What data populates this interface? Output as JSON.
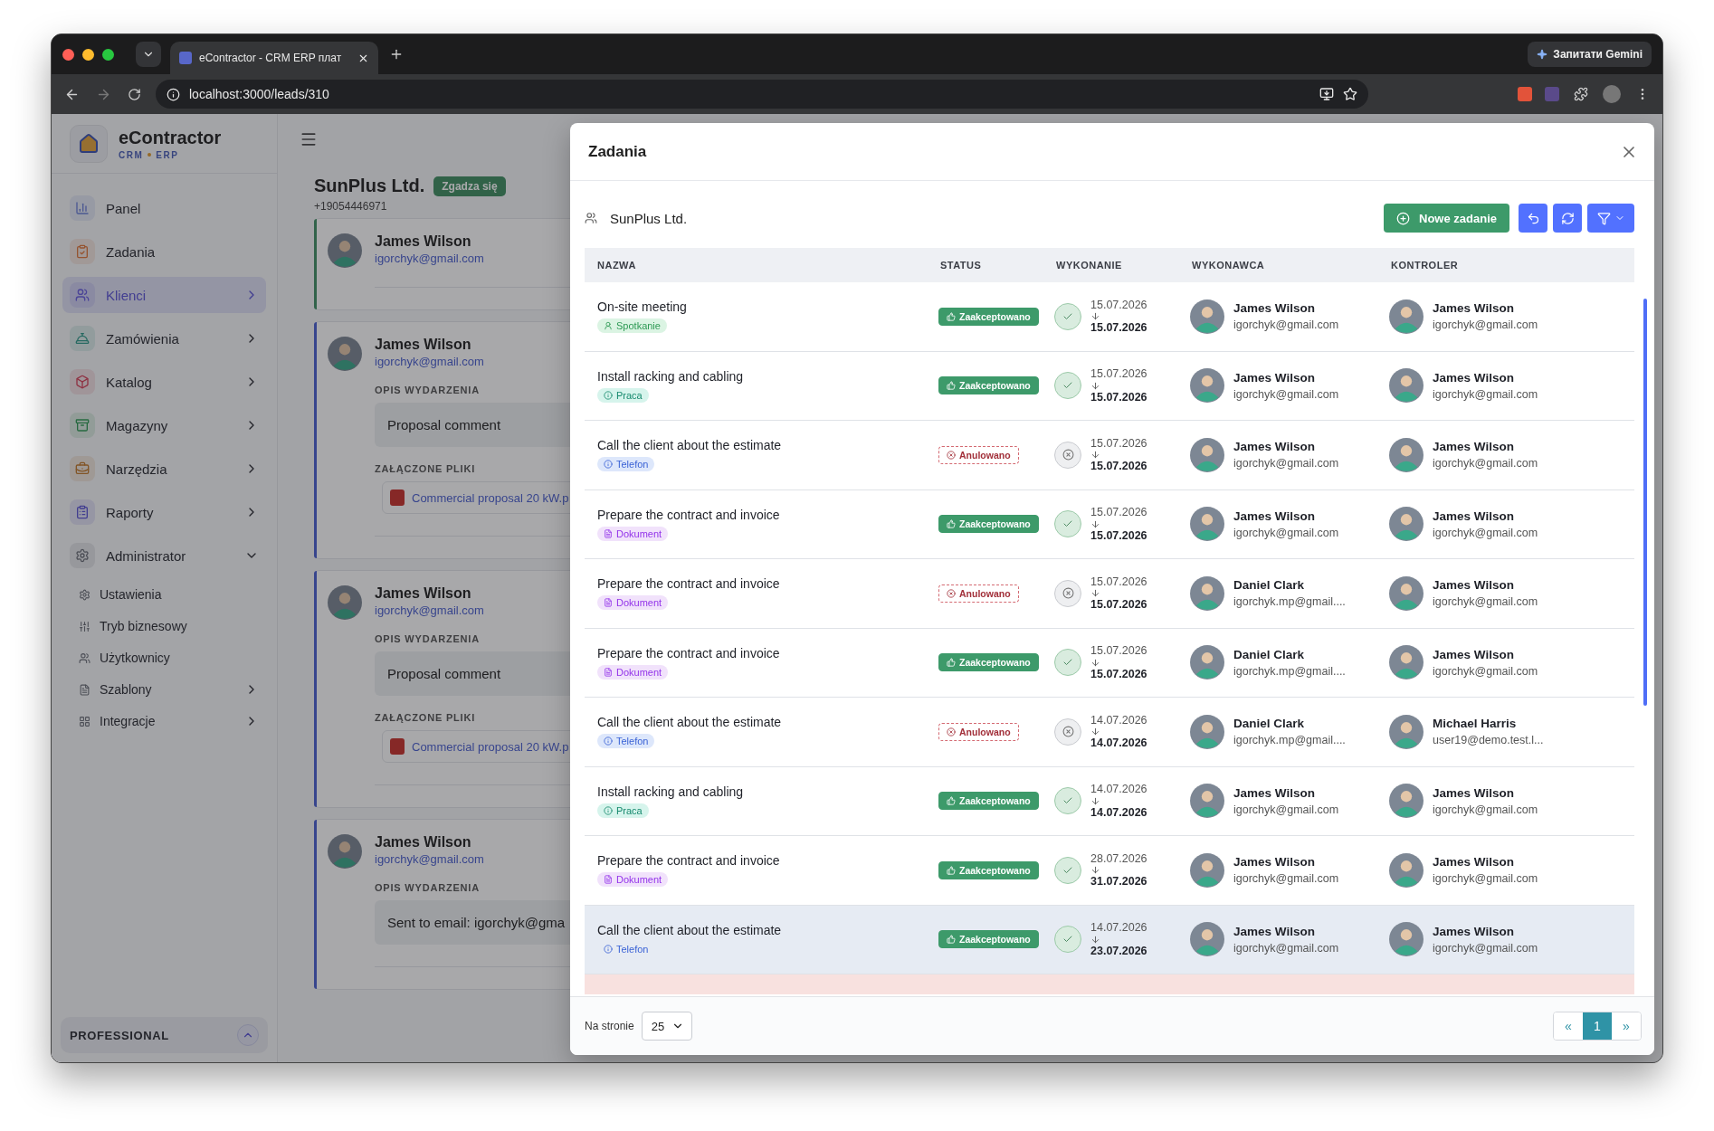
{
  "browser": {
    "tab_title": "eContractor - CRM ERP плат",
    "url": "localhost:3000/leads/310",
    "assistant_button": "Запитати Gemini"
  },
  "sidebar": {
    "brand": "eContractor",
    "brand_sub": [
      "CRM",
      "ERP"
    ],
    "items": [
      {
        "label": "Panel",
        "selected": false
      },
      {
        "label": "Zadania",
        "selected": false
      },
      {
        "label": "Klienci",
        "selected": true,
        "expanded": false
      },
      {
        "label": "Zamówienia",
        "selected": false,
        "expanded": false
      },
      {
        "label": "Katalog",
        "selected": false,
        "expanded": false
      },
      {
        "label": "Magazyny",
        "selected": false,
        "expanded": false
      },
      {
        "label": "Narzędzia",
        "selected": false,
        "expanded": false
      },
      {
        "label": "Raporty",
        "selected": false,
        "expanded": false
      },
      {
        "label": "Administrator",
        "selected": false,
        "expanded": true,
        "children": [
          {
            "label": "Ustawienia"
          },
          {
            "label": "Tryb biznesowy"
          },
          {
            "label": "Użytkownicy"
          },
          {
            "label": "Szablony",
            "expanded": false
          },
          {
            "label": "Integracje",
            "expanded": false
          }
        ]
      }
    ],
    "plan": "PROFESSIONAL"
  },
  "lead": {
    "name": "SunPlus Ltd.",
    "status": "Zgadza się",
    "phone": "+19054446971"
  },
  "events": [
    {
      "author": "James Wilson",
      "email": "igorchyk@gmail.com",
      "color": "#31634a"
    },
    {
      "author": "James Wilson",
      "email": "igorchyk@gmail.com",
      "color": "#37458d",
      "description_label": "OPIS WYDARZENIA",
      "description": "Proposal comment",
      "files_label": "ZAŁĄCZONE PLIKI",
      "files": [
        "Commercial proposal 20 kW.p"
      ]
    },
    {
      "author": "James Wilson",
      "email": "igorchyk@gmail.com",
      "color": "#37458d",
      "description_label": "OPIS WYDARZENIA",
      "description": "Proposal comment",
      "files_label": "ZAŁĄCZONE PLIKI",
      "files": [
        "Commercial proposal 20 kW.p"
      ]
    },
    {
      "author": "James Wilson",
      "email": "igorchyk@gmail.com",
      "color": "#37458d",
      "description_label": "OPIS WYDARZENIA",
      "description": "Sent to email: igorchyk@gma"
    }
  ],
  "modal": {
    "title": "Zadania",
    "client": "SunPlus Ltd.",
    "new_button": "Nowe zadanie",
    "columns": [
      "NAZWA",
      "STATUS",
      "WYKONANIE",
      "WYKONAWCA",
      "KONTROLER"
    ],
    "rows": [
      {
        "title": "On-site meeting",
        "tag": {
          "label": "Spotkanie",
          "kind": "meeting"
        },
        "status": {
          "label": "Zaakceptowano",
          "kind": "accepted"
        },
        "date_from": "15.07.2026",
        "date_to": "15.07.2026",
        "executor": {
          "name": "James Wilson",
          "email": "igorchyk@gmail.com"
        },
        "controller": {
          "name": "James Wilson",
          "email": "igorchyk@gmail.com"
        },
        "highlighted": false
      },
      {
        "title": "Install racking and cabling",
        "tag": {
          "label": "Praca",
          "kind": "work"
        },
        "status": {
          "label": "Zaakceptowano",
          "kind": "accepted"
        },
        "date_from": "15.07.2026",
        "date_to": "15.07.2026",
        "executor": {
          "name": "James Wilson",
          "email": "igorchyk@gmail.com"
        },
        "controller": {
          "name": "James Wilson",
          "email": "igorchyk@gmail.com"
        },
        "highlighted": false
      },
      {
        "title": "Call the client about the estimate",
        "tag": {
          "label": "Telefon",
          "kind": "phone"
        },
        "status": {
          "label": "Anulowano",
          "kind": "cancelled"
        },
        "date_from": "15.07.2026",
        "date_to": "15.07.2026",
        "executor": {
          "name": "James Wilson",
          "email": "igorchyk@gmail.com"
        },
        "controller": {
          "name": "James Wilson",
          "email": "igorchyk@gmail.com"
        },
        "highlighted": false
      },
      {
        "title": "Prepare the contract and invoice",
        "tag": {
          "label": "Dokument",
          "kind": "document"
        },
        "status": {
          "label": "Zaakceptowano",
          "kind": "accepted"
        },
        "date_from": "15.07.2026",
        "date_to": "15.07.2026",
        "executor": {
          "name": "James Wilson",
          "email": "igorchyk@gmail.com"
        },
        "controller": {
          "name": "James Wilson",
          "email": "igorchyk@gmail.com"
        },
        "highlighted": false
      },
      {
        "title": "Prepare the contract and invoice",
        "tag": {
          "label": "Dokument",
          "kind": "document"
        },
        "status": {
          "label": "Anulowano",
          "kind": "cancelled"
        },
        "date_from": "15.07.2026",
        "date_to": "15.07.2026",
        "executor": {
          "name": "Daniel Clark",
          "email": "igorchyk.mp@gmail...."
        },
        "controller": {
          "name": "James Wilson",
          "email": "igorchyk@gmail.com"
        },
        "highlighted": false
      },
      {
        "title": "Prepare the contract and invoice",
        "tag": {
          "label": "Dokument",
          "kind": "document"
        },
        "status": {
          "label": "Zaakceptowano",
          "kind": "accepted"
        },
        "date_from": "15.07.2026",
        "date_to": "15.07.2026",
        "executor": {
          "name": "Daniel Clark",
          "email": "igorchyk.mp@gmail...."
        },
        "controller": {
          "name": "James Wilson",
          "email": "igorchyk@gmail.com"
        },
        "highlighted": false
      },
      {
        "title": "Call the client about the estimate",
        "tag": {
          "label": "Telefon",
          "kind": "phone"
        },
        "status": {
          "label": "Anulowano",
          "kind": "cancelled"
        },
        "date_from": "14.07.2026",
        "date_to": "14.07.2026",
        "executor": {
          "name": "Daniel Clark",
          "email": "igorchyk.mp@gmail...."
        },
        "controller": {
          "name": "Michael Harris",
          "email": "user19@demo.test.l..."
        },
        "highlighted": false
      },
      {
        "title": "Install racking and cabling",
        "tag": {
          "label": "Praca",
          "kind": "work"
        },
        "status": {
          "label": "Zaakceptowano",
          "kind": "accepted"
        },
        "date_from": "14.07.2026",
        "date_to": "14.07.2026",
        "executor": {
          "name": "James Wilson",
          "email": "igorchyk@gmail.com"
        },
        "controller": {
          "name": "James Wilson",
          "email": "igorchyk@gmail.com"
        },
        "highlighted": false
      },
      {
        "title": "Prepare the contract and invoice",
        "tag": {
          "label": "Dokument",
          "kind": "document"
        },
        "status": {
          "label": "Zaakceptowano",
          "kind": "accepted"
        },
        "date_from": "28.07.2026",
        "date_to": "31.07.2026",
        "executor": {
          "name": "James Wilson",
          "email": "igorchyk@gmail.com"
        },
        "controller": {
          "name": "James Wilson",
          "email": "igorchyk@gmail.com"
        },
        "highlighted": false
      },
      {
        "title": "Call the client about the estimate",
        "tag": {
          "label": "Telefon",
          "kind": "phone"
        },
        "status": {
          "label": "Zaakceptowano",
          "kind": "accepted"
        },
        "date_from": "14.07.2026",
        "date_to": "23.07.2026",
        "executor": {
          "name": "James Wilson",
          "email": "igorchyk@gmail.com"
        },
        "controller": {
          "name": "James Wilson",
          "email": "igorchyk@gmail.com"
        },
        "highlighted": true
      }
    ],
    "per_page_label": "Na stronie",
    "per_page": "25",
    "pagination": {
      "prev": "«",
      "next": "»",
      "pages": [
        {
          "label": "1",
          "selected": true
        }
      ]
    }
  }
}
